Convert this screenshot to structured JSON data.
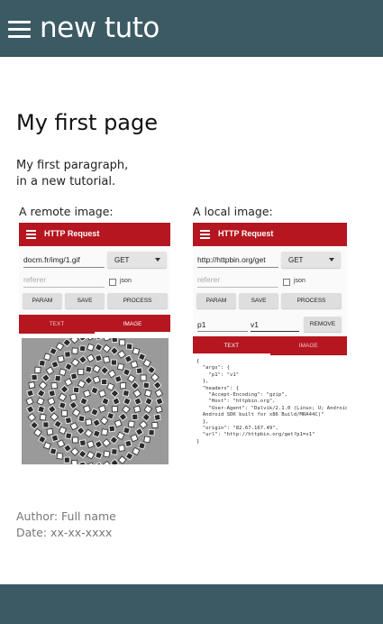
{
  "header": {
    "title": "new tuto",
    "menu_icon": "hamburger-icon"
  },
  "page": {
    "title": "My first page",
    "paragraph_line1": "My first paragraph,",
    "paragraph_line2": "in a new tutorial.",
    "remote_caption": "A remote image:",
    "local_caption": "A local image:"
  },
  "remote_app": {
    "title": "HTTP Request",
    "url": "docm.fr/img/1.gif",
    "method": "GET",
    "referer_placeholder": "referer",
    "json_label": "json",
    "buttons": [
      "PARAM",
      "SAVE",
      "PROCESS"
    ],
    "tabs": [
      "TEXT",
      "IMAGE"
    ],
    "active_tab": "IMAGE"
  },
  "local_app": {
    "title": "HTTP Request",
    "url": "http://httpbin.org/get",
    "method": "GET",
    "referer_placeholder": "referer",
    "json_label": "json",
    "buttons": [
      "PARAM",
      "SAVE",
      "PROCESS"
    ],
    "param_key": "p1",
    "param_value": "v1",
    "remove_label": "REMOVE",
    "tabs": [
      "TEXT",
      "IMAGE"
    ],
    "active_tab": "TEXT",
    "response": "{\n  \"args\": {\n    \"p1\": \"v1\"\n  },\n  \"headers\": {\n    \"Accept-Encoding\": \"gzip\",\n    \"Host\": \"httpbin.org\",\n    \"User-Agent\": \"Dalvik/2.1.0 (Linux; U; Android 6.0;\n  Android SDK built for x86 Build/MRA44C)\"\n  },\n  \"origin\": \"82.67.167.49\",\n  \"url\": \"http://httpbin.org/get?p1=v1\"\n}"
  },
  "footer_info": {
    "author": "Author: Full name",
    "date": "Date: xx-xx-xxxx"
  },
  "colors": {
    "topbar": "#3b5a63",
    "app_red": "#b5161f"
  }
}
